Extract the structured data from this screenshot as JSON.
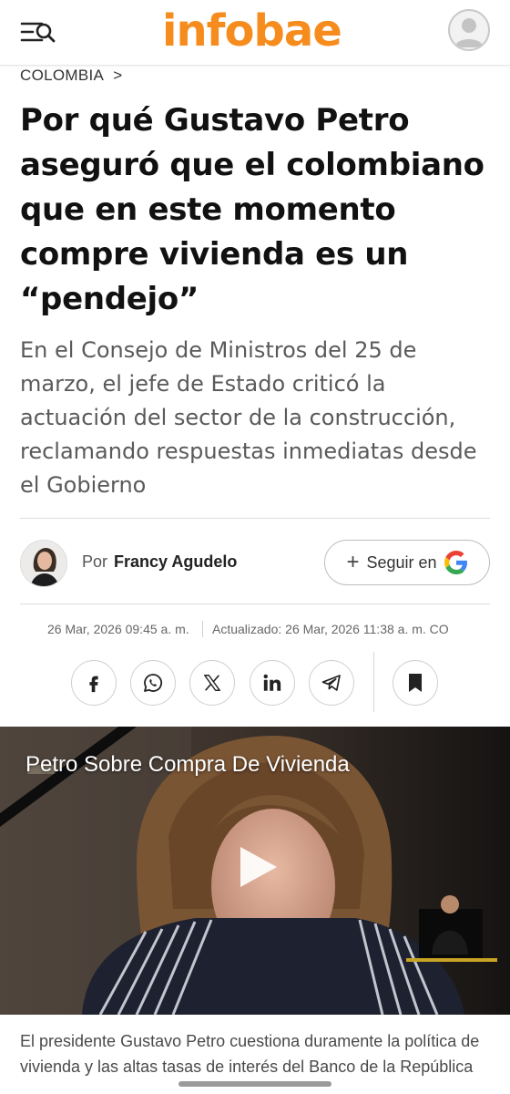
{
  "header": {
    "logo_text": "infobae",
    "menu_icon": "menu-search-icon",
    "account_icon": "user-avatar-icon",
    "brand_color": "#f68c1e"
  },
  "breadcrumb": {
    "section": "COLOMBIA",
    "chevron": ">"
  },
  "article": {
    "headline": "Por qué Gustavo Petro aseguró que el colombiano que en este momento compre vivienda es un “pendejo”",
    "subhead": "En el Consejo de Ministros del 25 de marzo, el jefe de Estado criticó la actuación del sector de la construcción, reclamando respuestas inmediatas desde el Gobierno",
    "author": {
      "by_label": "Por",
      "name": "Francy Agudelo"
    },
    "follow_button": {
      "plus": "+",
      "label": "Seguir en",
      "icon": "google-g-icon"
    },
    "published": "26 Mar, 2026 09:45 a. m.",
    "updated": "Actualizado: 26 Mar, 2026 11:38 a. m. CO",
    "share": [
      {
        "name": "facebook-icon"
      },
      {
        "name": "whatsapp-icon"
      },
      {
        "name": "x-icon"
      },
      {
        "name": "linkedin-icon"
      },
      {
        "name": "telegram-icon"
      }
    ],
    "bookmark_icon": "bookmark-icon",
    "video": {
      "title": "Petro Sobre Compra De Vivienda",
      "play_icon": "play-icon"
    },
    "caption": "El presidente Gustavo Petro cuestiona duramente la política de vivienda y las altas tasas de interés del Banco de la República"
  }
}
